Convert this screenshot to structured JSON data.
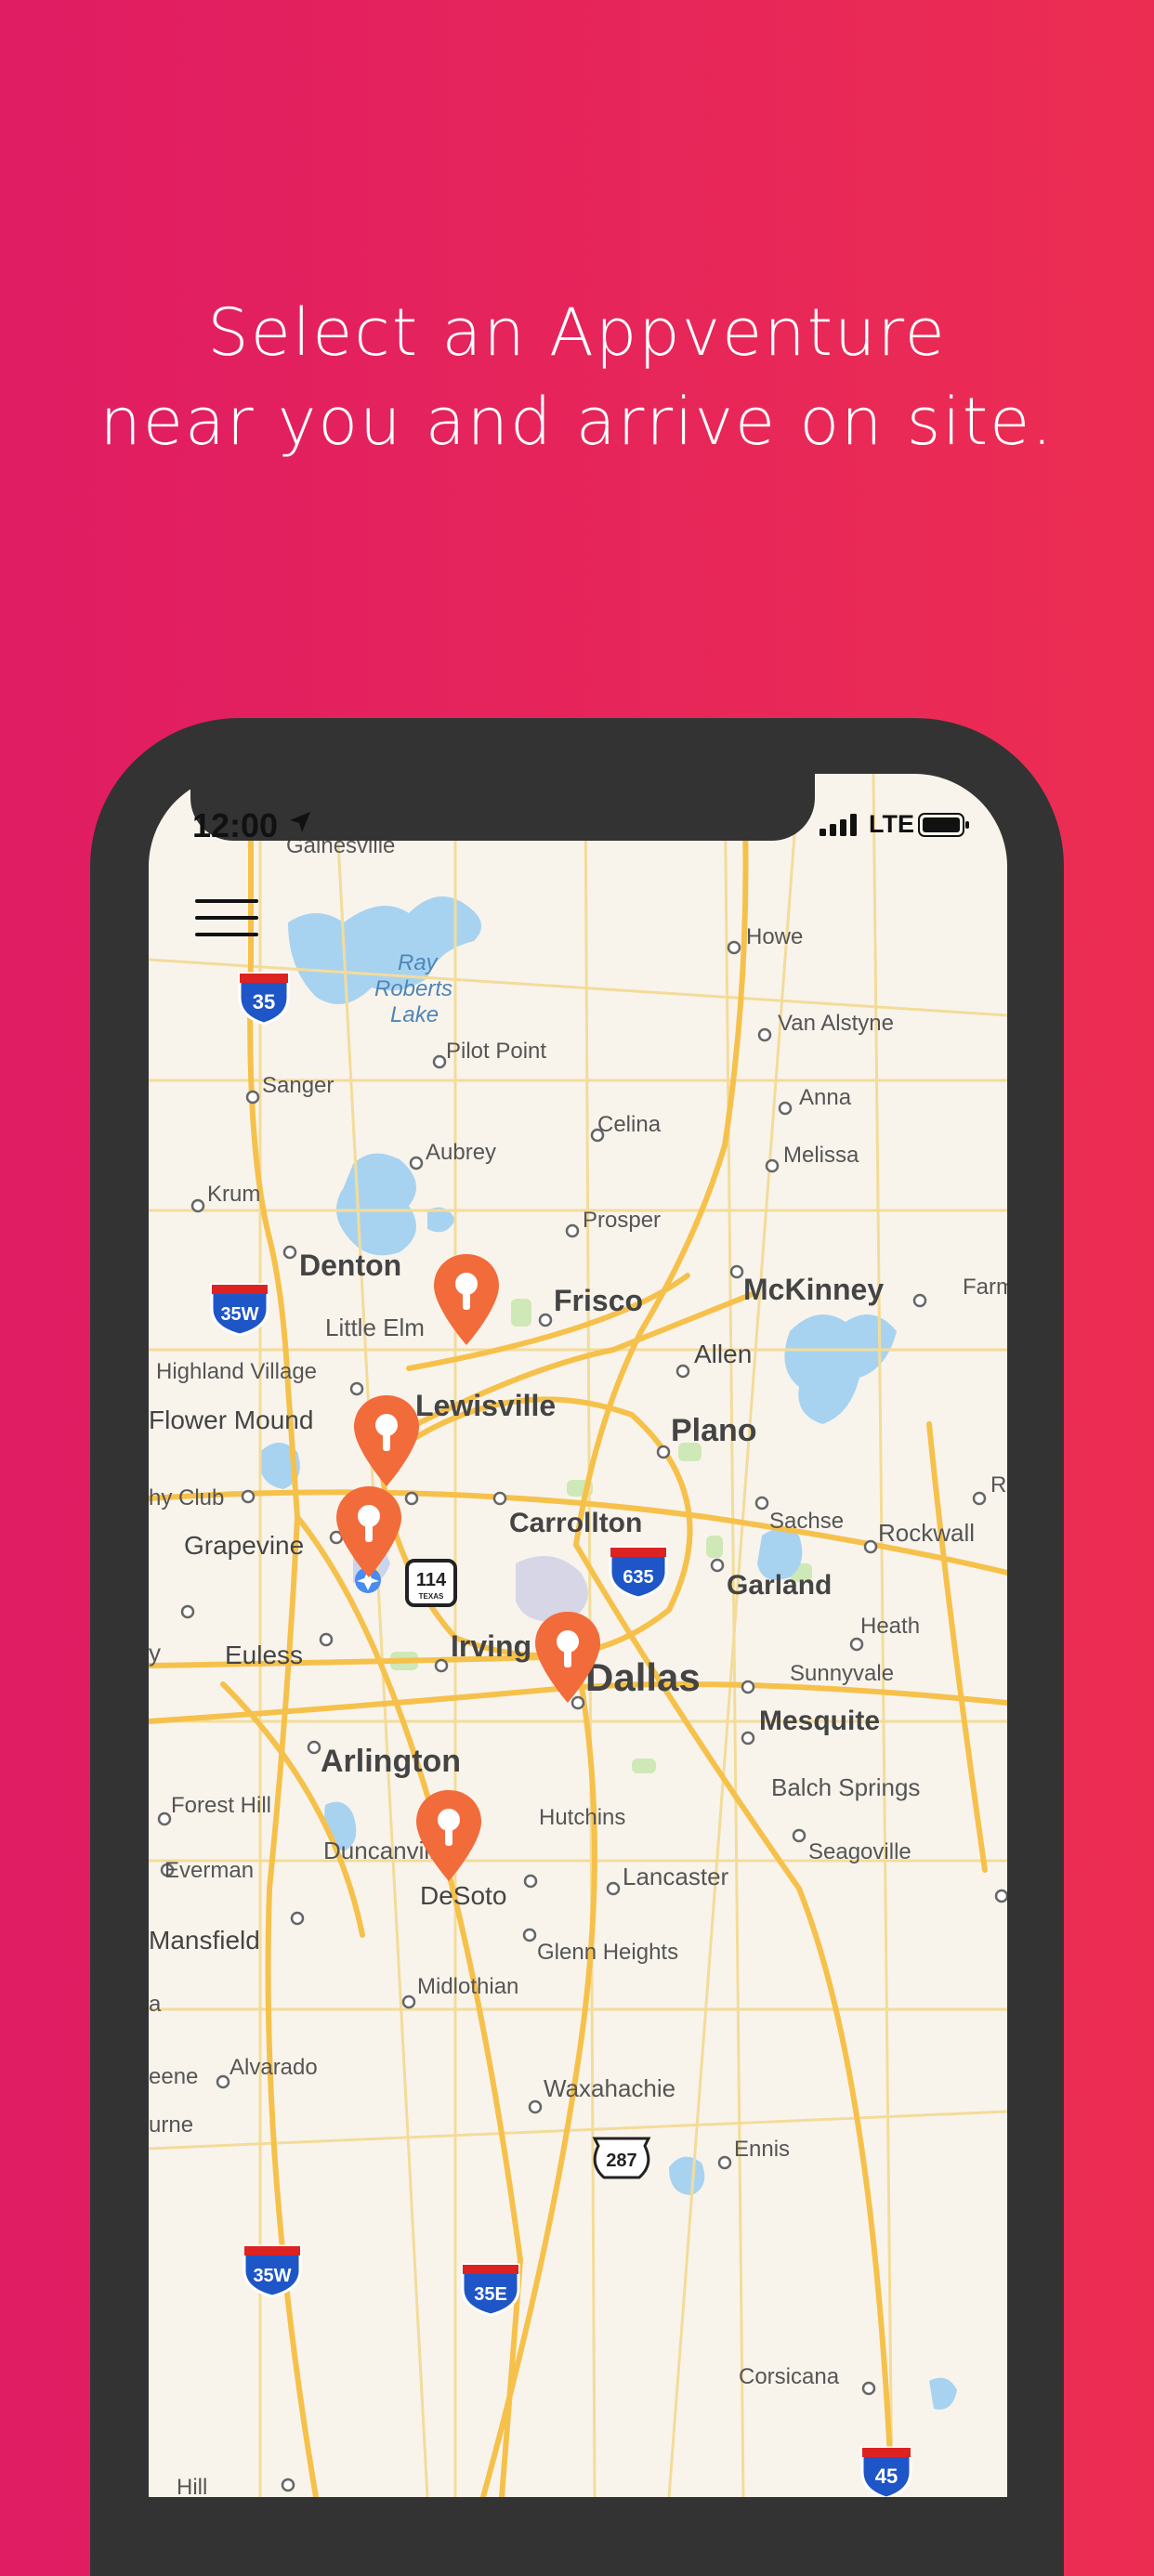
{
  "headline": {
    "line1": "Select an Appventure",
    "line2": "near you and arrive on site."
  },
  "status_bar": {
    "time": "12:00",
    "network": "LTE",
    "icons": [
      "location-arrow-icon",
      "signal-icon",
      "battery-icon"
    ]
  },
  "menu": {
    "icon": "hamburger-menu-icon"
  },
  "map": {
    "colors": {
      "background": "#F8F4EC",
      "water": "#A8D3F0",
      "highway": "#F6C14B",
      "road": "#F3DC9A",
      "park": "#CFE8B7",
      "pin": "#F26B3A"
    },
    "places": [
      "Gainesville",
      "Howe",
      "Ray",
      "Roberts",
      "Lake",
      "Van Alstyne",
      "Pilot Point",
      "Sanger",
      "Anna",
      "Celina",
      "Aubrey",
      "Melissa",
      "Krum",
      "Prosper",
      "Denton",
      "Frisco",
      "McKinney",
      "Farm",
      "Little Elm",
      "Allen",
      "Highland Village",
      "Lewisville",
      "Plano",
      "Flower Mound",
      "hy Club",
      "Sachse",
      "Ro",
      "Rockwall",
      "Carrollton",
      "Grapevine",
      "Garland",
      "Heath",
      "y",
      "Euless",
      "Irving",
      "Dallas",
      "Sunnyvale",
      "Mesquite",
      "Arlington",
      "Forest Hill",
      "Balch Springs",
      "Hutchins",
      "Everman",
      "Duncanville",
      "Seagoville",
      "Lancaster",
      "DeSoto",
      "Mansfield",
      "Glenn Heights",
      "Midlothian",
      "a",
      "Alvarado",
      "Waxahachie",
      "eene",
      "Ennis",
      "urne",
      "Corsicana",
      "Hill"
    ],
    "shields": [
      "35",
      "35W",
      "635",
      "114",
      "TEXAS",
      "287",
      "35W",
      "35E",
      "45"
    ],
    "pins": [
      {
        "name": "appventure-pin-mckinney"
      },
      {
        "name": "appventure-pin-plano"
      },
      {
        "name": "appventure-pin-grapevine"
      },
      {
        "name": "appventure-pin-dallas"
      },
      {
        "name": "appventure-pin-desoto"
      }
    ]
  }
}
